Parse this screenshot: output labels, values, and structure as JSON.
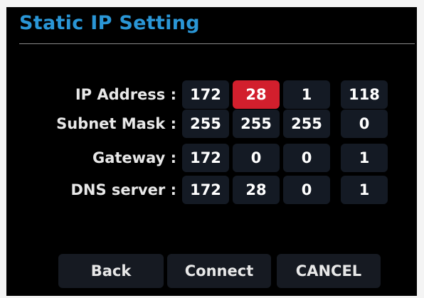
{
  "title": "Static IP Setting",
  "rows": [
    {
      "label": "IP Address :",
      "octets": [
        "172",
        "28",
        "1",
        "118"
      ]
    },
    {
      "label": "Subnet Mask :",
      "octets": [
        "255",
        "255",
        "255",
        "0"
      ]
    },
    {
      "label": "Gateway :",
      "octets": [
        "172",
        "0",
        "0",
        "1"
      ]
    },
    {
      "label": "DNS server :",
      "octets": [
        "172",
        "28",
        "0",
        "1"
      ]
    }
  ],
  "selected_field": "IP Address octet 2",
  "buttons": {
    "back": "Back",
    "connect": "Connect",
    "cancel": "CANCEL"
  },
  "colors": {
    "title": "#2a96d6",
    "selected": "#d21f2d",
    "field_bg": "#141a24",
    "background": "#000000"
  }
}
